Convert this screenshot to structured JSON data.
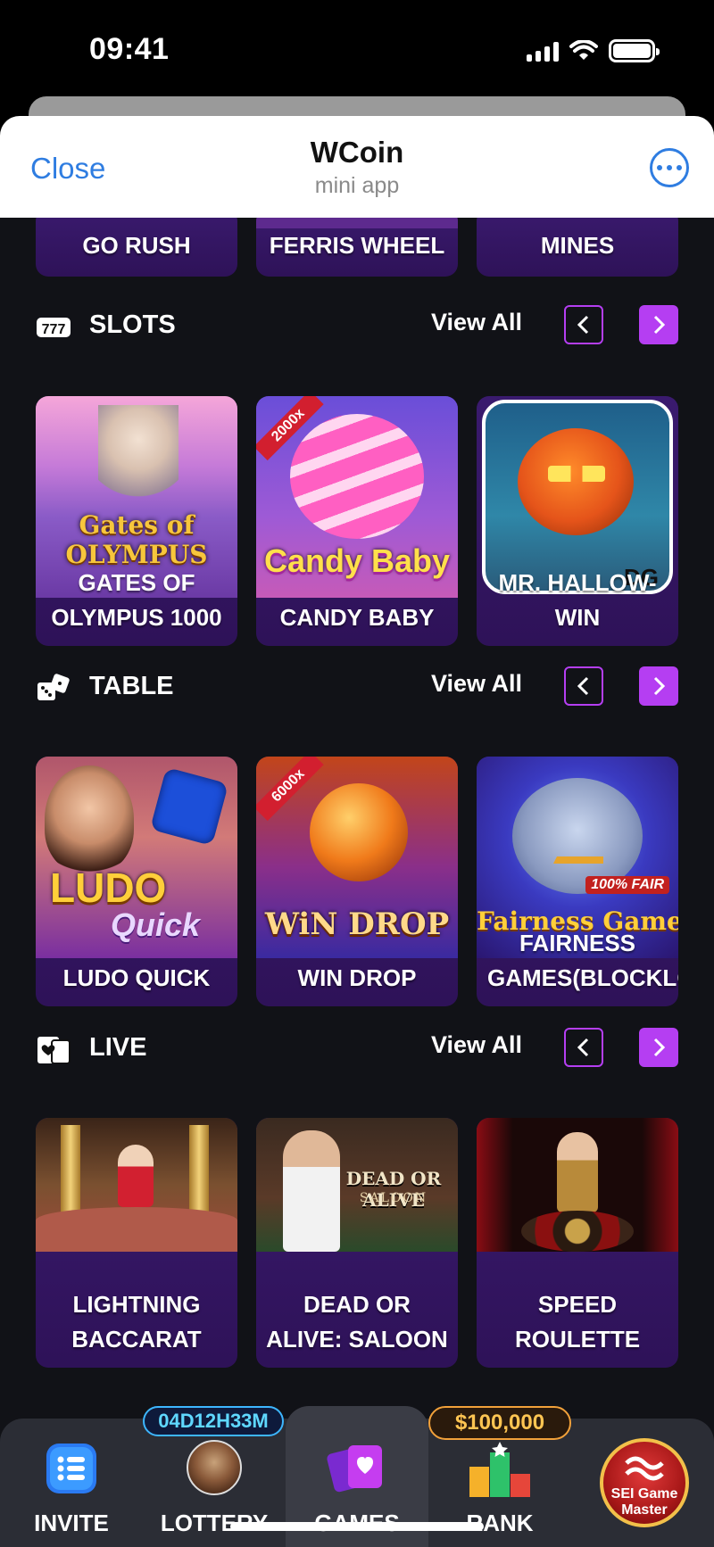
{
  "status": {
    "time": "09:41"
  },
  "header": {
    "close": "Close",
    "title": "WCoin",
    "subtitle": "mini app"
  },
  "top_row": [
    {
      "label": "GO RUSH"
    },
    {
      "label": "FERRIS WHEEL"
    },
    {
      "label": "MINES"
    }
  ],
  "sections": [
    {
      "title": "SLOTS",
      "view_all": "View All",
      "games": [
        {
          "line1": "GATES OF",
          "line2": "OLYMPUS 1000",
          "art_text": "Gates of OLYMPUS"
        },
        {
          "line1": "",
          "line2": "CANDY BABY",
          "art_text": "Candy Baby",
          "badge": "2000x"
        },
        {
          "line1": "MR. HALLOW-",
          "line2": "WIN",
          "art_text": "DG"
        }
      ]
    },
    {
      "title": "TABLE",
      "view_all": "View All",
      "games": [
        {
          "line1": "",
          "line2": "LUDO QUICK",
          "art_text": "LUDO",
          "art_text2": "Quick"
        },
        {
          "line1": "",
          "line2": "WIN DROP",
          "art_text": "WiN DROP",
          "badge": "6000x"
        },
        {
          "line1": "FAIRNESS",
          "line2": "GAMES(BLOCKLC",
          "art_text": "Fairness Games",
          "badge": "100% FAIR"
        }
      ]
    },
    {
      "title": "LIVE",
      "view_all": "View All",
      "games": [
        {
          "line1": "LIGHTNING",
          "line2": "BACCARAT"
        },
        {
          "line1": "DEAD OR",
          "line2": "ALIVE: SALOON",
          "art_text": "DEAD OR ALIVE",
          "art_text2": "SALOON"
        },
        {
          "line1": "SPEED",
          "line2": "ROULETTE"
        }
      ]
    }
  ],
  "nav": {
    "invite": "INVITE",
    "lottery": "LOTTERY",
    "games": "GAMES",
    "rank": "RANK",
    "sei_line1": "SEI Game",
    "sei_line2": "Master",
    "timer": "04D12H33M",
    "prize": "$100,000"
  }
}
